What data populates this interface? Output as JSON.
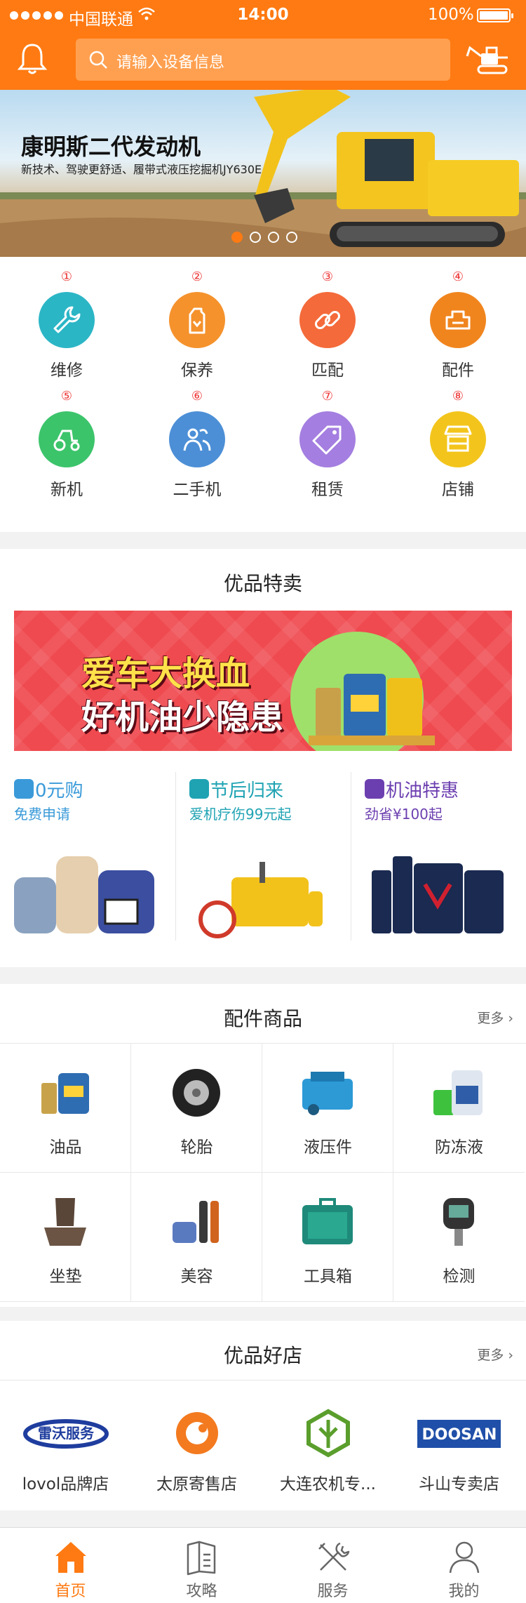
{
  "status_bar": {
    "carrier": "中国联通",
    "time": "14:00",
    "battery": "100%"
  },
  "header": {
    "search_placeholder": "请输入设备信息"
  },
  "banner": {
    "title": "康明斯二代发动机",
    "subtitle": "新技术、驾驶更舒适、履带式液压挖掘机JY630E",
    "active_dot": 0,
    "dot_count": 4
  },
  "categories": [
    {
      "num": "①",
      "label": "维修",
      "color": "#2bb6c6",
      "icon": "wrench-icon"
    },
    {
      "num": "②",
      "label": "保养",
      "color": "#f5922c",
      "icon": "oil-can-icon"
    },
    {
      "num": "③",
      "label": "匹配",
      "color": "#f46a3a",
      "icon": "link-icon"
    },
    {
      "num": "④",
      "label": "配件",
      "color": "#f0851e",
      "icon": "engine-part-icon"
    },
    {
      "num": "⑤",
      "label": "新机",
      "color": "#3cc46b",
      "icon": "tractor-icon"
    },
    {
      "num": "⑥",
      "label": "二手机",
      "color": "#4c8fd6",
      "icon": "users-icon"
    },
    {
      "num": "⑦",
      "label": "租赁",
      "color": "#a47ee0",
      "icon": "tag-icon"
    },
    {
      "num": "⑧",
      "label": "店铺",
      "color": "#f3c51c",
      "icon": "store-icon"
    }
  ],
  "featured": {
    "title": "优品特卖",
    "promo_line1": "爱车大换血",
    "promo_line2": "好机油少隐患",
    "deals": [
      {
        "title": "0元购",
        "sub": "免费申请",
        "title_color": "#3a9ad9",
        "sub_color": "#3a9ad9",
        "icon_color": "#3a9ad9",
        "icon": "thumbs-up-icon"
      },
      {
        "title": "节后归来",
        "sub": "爱机疗伤99元起",
        "title_color": "#1fa3b3",
        "sub_color": "#1fa3b3",
        "icon_color": "#1fa3b3",
        "icon": "sun-icon"
      },
      {
        "title": "机油特惠",
        "sub": "劲省¥100起",
        "title_color": "#6c3fb0",
        "sub_color": "#6c3fb0",
        "icon_color": "#6c3fb0",
        "icon": "price-tag-icon"
      }
    ]
  },
  "parts": {
    "title": "配件商品",
    "more": "更多",
    "items": [
      {
        "label": "油品",
        "icon": "motor-oil-icon"
      },
      {
        "label": "轮胎",
        "icon": "tire-icon"
      },
      {
        "label": "液压件",
        "icon": "hydraulic-engine-icon"
      },
      {
        "label": "防冻液",
        "icon": "antifreeze-icon"
      },
      {
        "label": "坐垫",
        "icon": "seat-cushion-icon"
      },
      {
        "label": "美容",
        "icon": "car-care-icon"
      },
      {
        "label": "工具箱",
        "icon": "toolbox-icon"
      },
      {
        "label": "检测",
        "icon": "tire-gauge-icon"
      }
    ]
  },
  "shops": {
    "title": "优品好店",
    "more": "更多",
    "items": [
      {
        "label": "lovol品牌店",
        "logo_text": "雷沃服务"
      },
      {
        "label": "太原寄售店",
        "logo_text": ""
      },
      {
        "label": "大连农机专...",
        "logo_text": ""
      },
      {
        "label": "斗山专卖店",
        "logo_text": "DOOSAN"
      }
    ]
  },
  "tabbar": [
    {
      "label": "首页",
      "icon": "home-icon",
      "active": true
    },
    {
      "label": "攻略",
      "icon": "guide-book-icon",
      "active": false
    },
    {
      "label": "服务",
      "icon": "tools-icon",
      "active": false
    },
    {
      "label": "我的",
      "icon": "profile-icon",
      "active": false
    }
  ],
  "colors": {
    "brand": "#ff7a12",
    "active_tab": "#ff7a12"
  }
}
